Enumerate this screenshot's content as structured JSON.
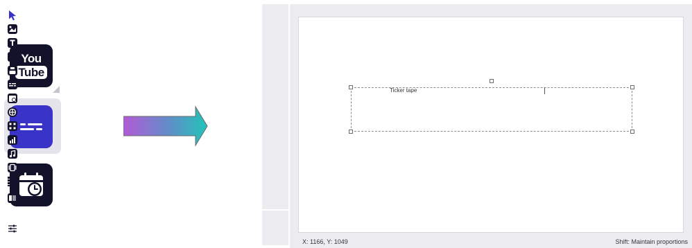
{
  "left_panel": {
    "youtube": {
      "icon": "youtube-icon",
      "line1": "You",
      "line2": "Tube"
    },
    "ticker": {
      "icon": "ticker-tape-icon",
      "selected": true,
      "color": "#3a33c8"
    },
    "calendar": {
      "icon": "calendar-clock-icon"
    }
  },
  "toolbar": {
    "tools": [
      "pointer-icon",
      "image-icon",
      "text-icon",
      "shape-icon",
      "youtube-icon",
      "ticker-tape-icon",
      "calendar-clock-icon",
      "globe-icon",
      "qr-code-icon",
      "chart-icon",
      "music-icon",
      "slideshow-icon",
      "grid-icon",
      "pdf-icon"
    ],
    "bottom_tool": "settings-sliders-icon",
    "active_color": "#3a33c8"
  },
  "canvas": {
    "element_label": "Ticker tape"
  },
  "status": {
    "coords": "X: 1166, Y: 1049",
    "hint": "Shift: Maintain proportions"
  }
}
